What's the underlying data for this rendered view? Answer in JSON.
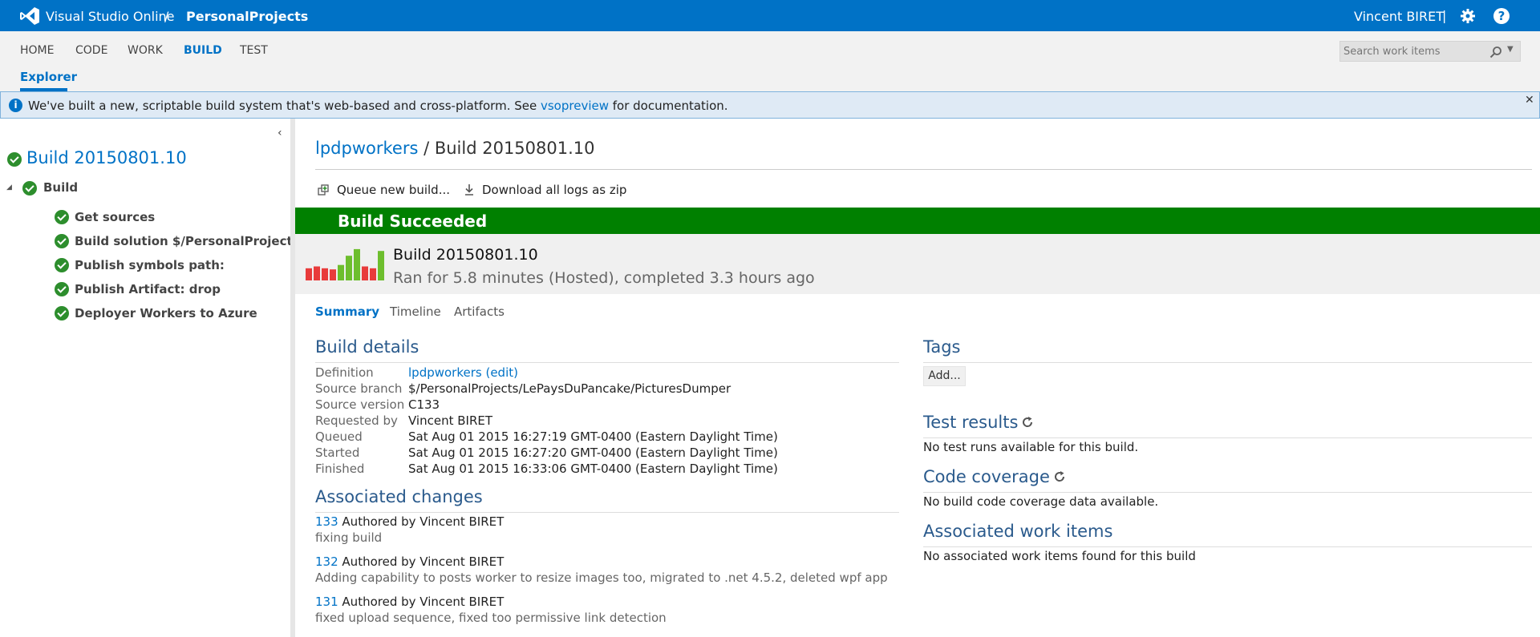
{
  "header": {
    "brand": "Visual Studio Online",
    "separator": "/",
    "project": "PersonalProjects",
    "user": "Vincent BIRET",
    "user_separator": "|",
    "help_label": "?"
  },
  "nav": {
    "items": [
      "HOME",
      "CODE",
      "WORK",
      "BUILD",
      "TEST"
    ],
    "active": "BUILD",
    "subnav": "Explorer",
    "search_placeholder": "Search work items"
  },
  "infobar": {
    "text_before": "We've built a new, scriptable build system that's web-based and cross-platform. See ",
    "link": "vsopreview",
    "text_after": " for documentation.",
    "close": "✕"
  },
  "tree": {
    "root": "Build 20150801.10",
    "group": "Build",
    "steps": [
      "Get sources",
      "Build solution $/PersonalProjects/L...",
      "Publish symbols path:",
      "Publish Artifact: drop",
      "Deployer Workers to Azure"
    ]
  },
  "main": {
    "definition": "lpdpworkers",
    "crumb_separator": " / ",
    "build_name": "Build 20150801.10",
    "toolbar": {
      "queue_label": "Queue new build...",
      "download_label": "Download all logs as zip"
    },
    "status": "Build Succeeded",
    "summary": {
      "build_number": "Build 20150801.10",
      "ran_text": "Ran for 5.8 minutes (Hosted), completed 3.3 hours ago"
    },
    "history_bars": [
      {
        "h": 0.33,
        "color": "#e83b3b"
      },
      {
        "h": 0.38,
        "color": "#e83b3b"
      },
      {
        "h": 0.33,
        "color": "#e83b3b"
      },
      {
        "h": 0.3,
        "color": "#e83b3b"
      },
      {
        "h": 0.42,
        "color": "#6dbe2d"
      },
      {
        "h": 0.67,
        "color": "#6dbe2d"
      },
      {
        "h": 0.85,
        "color": "#6dbe2d"
      },
      {
        "h": 0.38,
        "color": "#e83b3b"
      },
      {
        "h": 0.33,
        "color": "#e83b3b"
      },
      {
        "h": 0.8,
        "color": "#6dbe2d"
      }
    ],
    "tabs": [
      "Summary",
      "Timeline",
      "Artifacts"
    ],
    "active_tab": "Summary",
    "build_details": {
      "title": "Build details",
      "rows": [
        {
          "key": "Definition",
          "value": "lpdpworkers (edit)"
        },
        {
          "key": "Source branch",
          "value": "$/PersonalProjects/LePaysDuPancake/PicturesDumper"
        },
        {
          "key": "Source version",
          "value": "C133"
        },
        {
          "key": "Requested by",
          "value": "Vincent BIRET"
        },
        {
          "key": "Queued",
          "value": "Sat Aug 01 2015 16:27:19 GMT-0400 (Eastern Daylight Time)"
        },
        {
          "key": "Started",
          "value": "Sat Aug 01 2015 16:27:20 GMT-0400 (Eastern Daylight Time)"
        },
        {
          "key": "Finished",
          "value": "Sat Aug 01 2015 16:33:06 GMT-0400 (Eastern Daylight Time)"
        }
      ]
    },
    "associated_changes": {
      "title": "Associated changes",
      "items": [
        {
          "id": "133",
          "author": "Authored by Vincent BIRET",
          "message": "fixing build"
        },
        {
          "id": "132",
          "author": "Authored by Vincent BIRET",
          "message": "Adding capability to posts worker to resize images too, migrated to .net 4.5.2, deleted wpf app"
        },
        {
          "id": "131",
          "author": "Authored by Vincent BIRET",
          "message": "fixed upload sequence, fixed too permissive link detection"
        }
      ]
    },
    "tags": {
      "title": "Tags",
      "add_label": "Add..."
    },
    "test_results": {
      "title": "Test results",
      "text": "No test runs available for this build."
    },
    "code_coverage": {
      "title": "Code coverage",
      "text": "No build code coverage data available."
    },
    "work_items": {
      "title": "Associated work items",
      "text": "No associated work items found for this build"
    }
  },
  "colors": {
    "brand_blue": "#0072c6",
    "success_green": "#008000",
    "check_green": "#2d8e2d",
    "fail_red": "#e83b3b",
    "pass_green": "#6dbe2d"
  },
  "icons": [
    "vs-logo-icon",
    "gear-icon",
    "help-icon",
    "search-icon",
    "info-icon",
    "close-icon",
    "collapse-icon",
    "success-check-icon",
    "queue-build-icon",
    "download-icon",
    "refresh-icon"
  ]
}
